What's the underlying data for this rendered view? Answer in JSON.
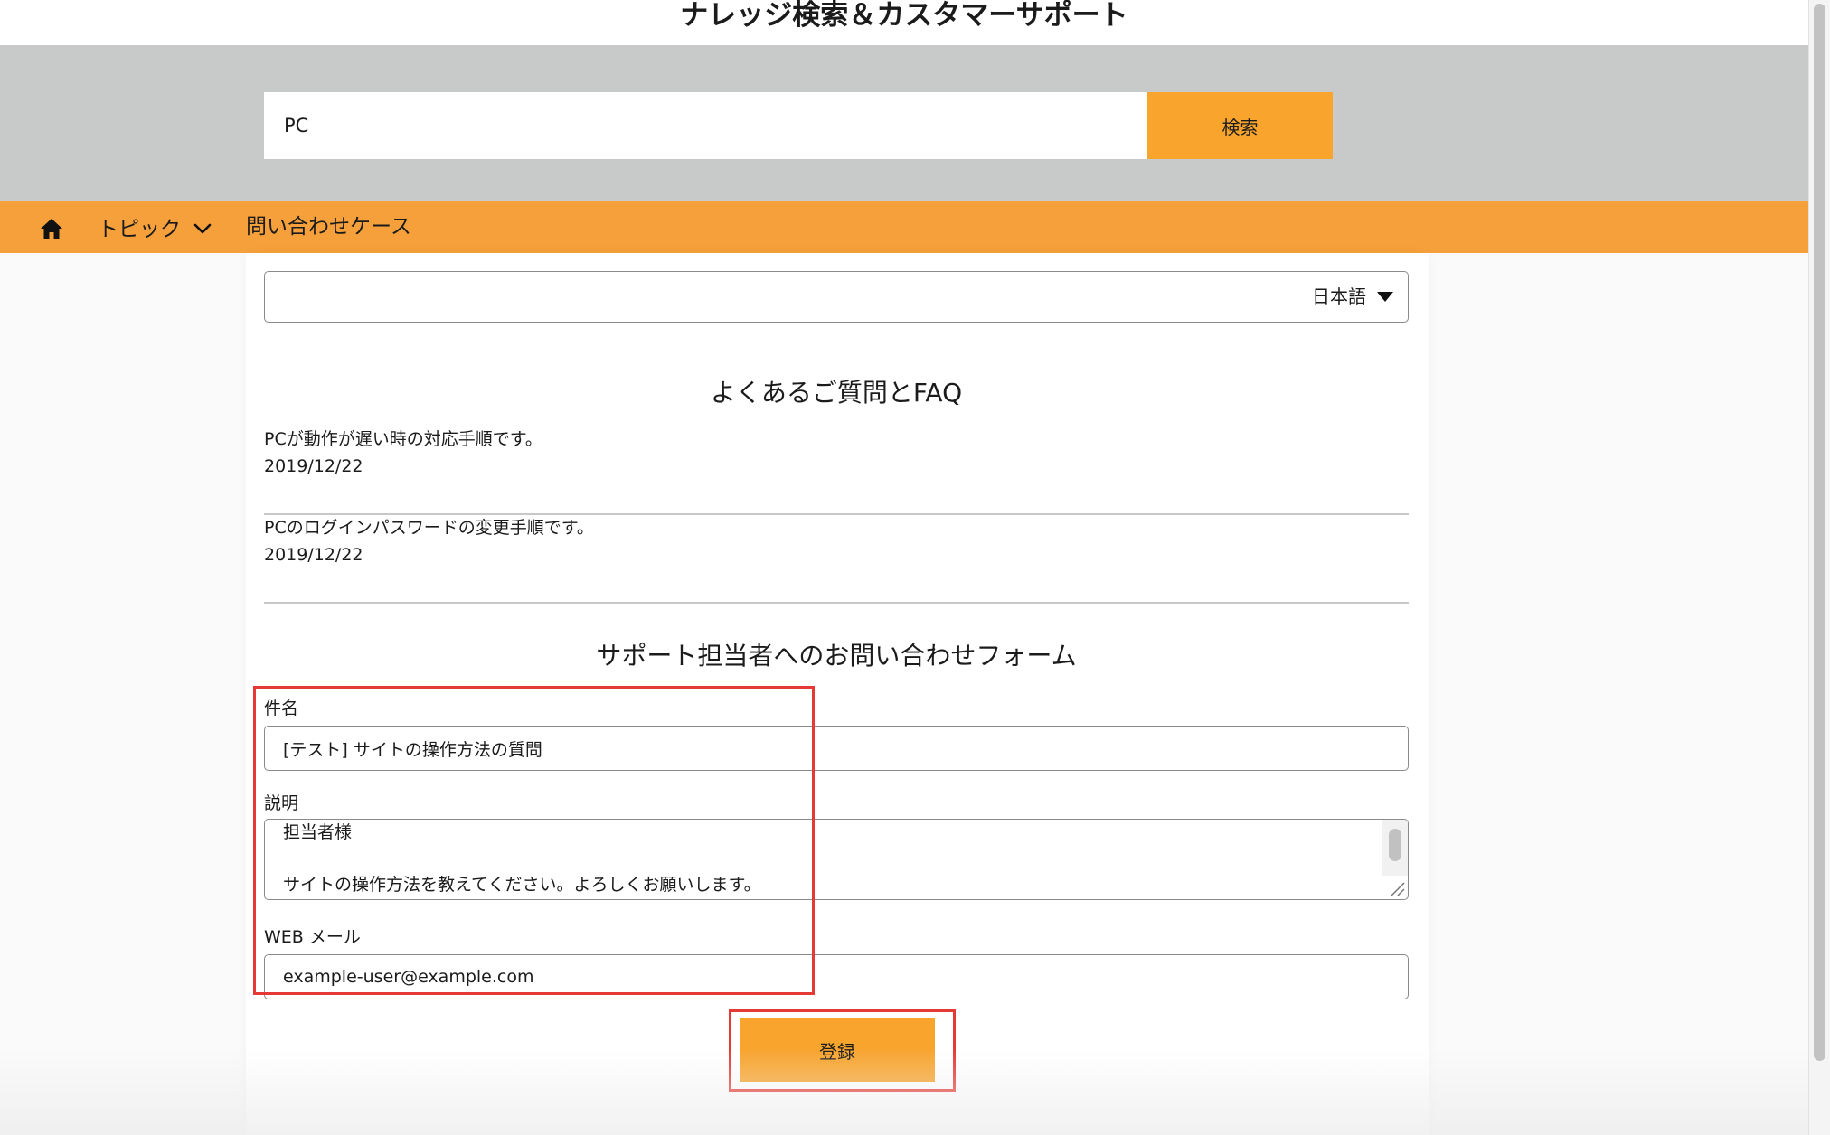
{
  "site": {
    "title": "ナレッジ検索＆カスタマーサポート"
  },
  "search": {
    "value": "PC",
    "button_label": "検索"
  },
  "nav": {
    "home_icon": "home-icon",
    "topic_label": "トピック",
    "cases_label": "問い合わせケース"
  },
  "language": {
    "selected": "日本語"
  },
  "faq": {
    "title": "よくあるご質問とFAQ",
    "items": [
      {
        "question": "PCが動作が遅い時の対応手順です。",
        "date": "2019/12/22"
      },
      {
        "question": "PCのログインパスワードの変更手順です。",
        "date": "2019/12/22"
      }
    ]
  },
  "form": {
    "title": "サポート担当者へのお問い合わせフォーム",
    "subject_label": "件名",
    "subject_value": "[テスト] サイトの操作方法の質問",
    "description_label": "説明",
    "description_value": "担当者様\n\nサイトの操作方法を教えてください。よろしくお願いします。",
    "email_label": "WEB メール",
    "email_value": "example-user@example.com",
    "submit_label": "登録"
  },
  "colors": {
    "accent": "#f8a42d",
    "nav_bar": "#f6a03c",
    "search_band": "#c8c9c9",
    "highlight": "#e53935"
  }
}
